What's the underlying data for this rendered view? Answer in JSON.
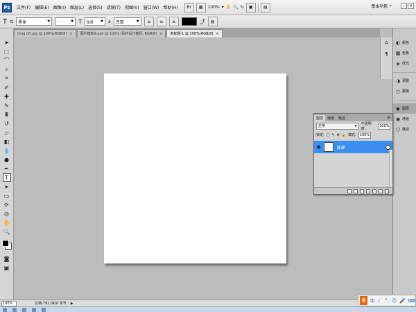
{
  "app": {
    "logo": "Ps"
  },
  "menu": {
    "items": [
      "文件(F)",
      "编辑(E)",
      "图像(I)",
      "图层(L)",
      "选择(S)",
      "滤镜(T)",
      "视图(V)",
      "窗口(W)",
      "帮助(H)"
    ],
    "zoom": "100%",
    "workspace": "基本功能"
  },
  "options": {
    "font_family": "黑体",
    "font_style": "-",
    "font_size": "9点",
    "antialias": "浑厚",
    "text_tool_icon": "T"
  },
  "tabs": [
    "timg (2).jpg @ 100%(RGB/8)",
    "图片模板9.psd @ 100% (素材设计教师, RGB/8)",
    "未标题-1 @ 100%(RGB/8)"
  ],
  "layers_panel": {
    "tabs": [
      "图层",
      "通道",
      "路径"
    ],
    "blend_mode": "正常",
    "opacity_label": "不透明度:",
    "opacity": "100%",
    "lock_label": "锁定:",
    "fill_label": "填充:",
    "fill": "100%",
    "layer_name": "背景"
  },
  "dock": {
    "items": [
      "颜色",
      "色板",
      "样式",
      "调整",
      "蒙版",
      "图层",
      "通道",
      "路径"
    ],
    "narrow_icons": [
      "A",
      "¶"
    ]
  },
  "status": {
    "zoom": "100%",
    "doc_info": "文档:791.0K/0 字节"
  },
  "ime": {
    "logo": "S",
    "lang": "中"
  }
}
